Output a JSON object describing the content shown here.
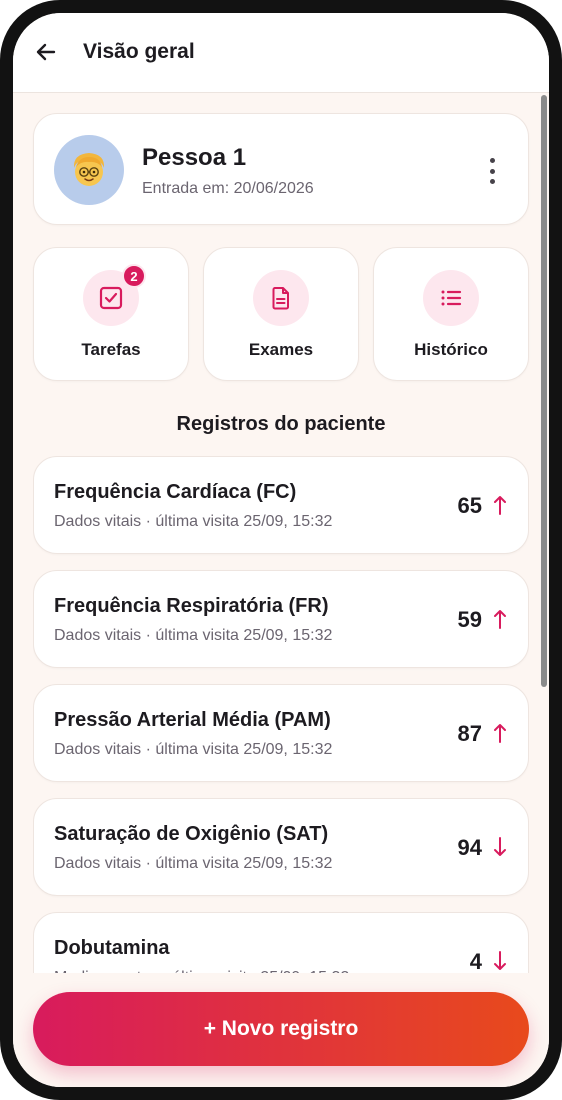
{
  "header": {
    "title": "Visão geral",
    "back_icon": "arrow-left-icon"
  },
  "profile": {
    "name": "Pessoa 1",
    "entry": "Entrada em: 20/06/2026",
    "avatar_icon": "person-emoji-icon",
    "more_icon": "more-vertical-icon"
  },
  "actions": [
    {
      "label": "Tarefas",
      "icon": "checkbox-icon",
      "badge": "2"
    },
    {
      "label": "Exames",
      "icon": "document-icon"
    },
    {
      "label": "Histórico",
      "icon": "list-icon"
    }
  ],
  "records_title": "Registros do paciente",
  "records": [
    {
      "title": "Frequência Cardíaca (FC)",
      "subtitle": "Dados vitais · última visita 25/09, 15:32",
      "value": "65",
      "trend": "up"
    },
    {
      "title": "Frequência Respiratória (FR)",
      "subtitle": "Dados vitais · última visita 25/09, 15:32",
      "value": "59",
      "trend": "up"
    },
    {
      "title": "Pressão Arterial Média (PAM)",
      "subtitle": "Dados vitais · última visita 25/09, 15:32",
      "value": "87",
      "trend": "up"
    },
    {
      "title": "Saturação de Oxigênio (SAT)",
      "subtitle": "Dados vitais · última visita 25/09, 15:32",
      "value": "94",
      "trend": "down"
    },
    {
      "title": "Dobutamina",
      "subtitle": "Medicamentos · última visita 25/09, 15:32",
      "value": "4",
      "trend": "down"
    }
  ],
  "cta": {
    "label": "+ Novo registro"
  },
  "colors": {
    "accent": "#d81b5d",
    "accent_end": "#e84a1c",
    "background": "#fdf6f2",
    "icon_bg": "#fde7ee"
  }
}
